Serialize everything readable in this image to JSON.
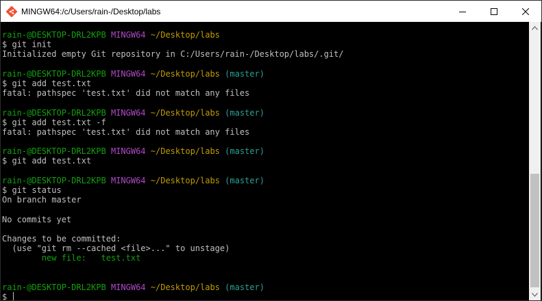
{
  "window": {
    "title": "MINGW64:/c/Users/rain-/Desktop/labs"
  },
  "controls": {
    "minimize": "minimize-icon",
    "maximize": "maximize-icon",
    "close": "close-icon"
  },
  "terminal": {
    "blocks": [
      {
        "prompt": {
          "user": "rain-@DESKTOP-DRL2KPB",
          "sys": "MINGW64",
          "path": "~/Desktop/labs",
          "branch": ""
        },
        "command": "$ git init",
        "output": [
          "Initialized empty Git repository in C:/Users/rain-/Desktop/labs/.git/"
        ]
      },
      {
        "prompt": {
          "user": "rain-@DESKTOP-DRL2KPB",
          "sys": "MINGW64",
          "path": "~/Desktop/labs",
          "branch": "(master)"
        },
        "command": "$ git add test.txt",
        "output": [
          "fatal: pathspec 'test.txt' did not match any files"
        ]
      },
      {
        "prompt": {
          "user": "rain-@DESKTOP-DRL2KPB",
          "sys": "MINGW64",
          "path": "~/Desktop/labs",
          "branch": "(master)"
        },
        "command": "$ git add test.txt -f",
        "output": [
          "fatal: pathspec 'test.txt' did not match any files"
        ]
      },
      {
        "prompt": {
          "user": "rain-@DESKTOP-DRL2KPB",
          "sys": "MINGW64",
          "path": "~/Desktop/labs",
          "branch": "(master)"
        },
        "command": "$ git add test.txt",
        "output": []
      },
      {
        "prompt": {
          "user": "rain-@DESKTOP-DRL2KPB",
          "sys": "MINGW64",
          "path": "~/Desktop/labs",
          "branch": "(master)"
        },
        "command": "$ git status",
        "output": [
          "On branch master",
          "",
          "No commits yet",
          "",
          "Changes to be committed:",
          "  (use \"git rm --cached <file>...\" to unstage)"
        ],
        "staged": "        new file:   test.txt"
      }
    ],
    "final_prompt": {
      "user": "rain-@DESKTOP-DRL2KPB",
      "sys": "MINGW64",
      "path": "~/Desktop/labs",
      "branch": "(master)"
    },
    "input_prefix": "$ "
  },
  "colors": {
    "user": "#13a10e",
    "system": "#b148c6",
    "path": "#c19c00",
    "branch": "#2aa198",
    "staged": "#13a10e",
    "text": "#c0c0c0"
  }
}
